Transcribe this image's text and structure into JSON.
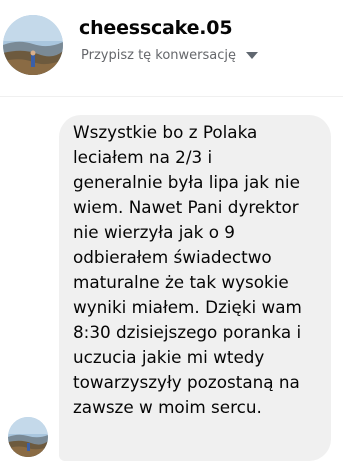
{
  "header": {
    "contact_name": "cheesscake.05",
    "subtitle": "Przypisz tę konwersację",
    "avatar_icon": "profile-photo-icon",
    "dropdown_icon": "chevron-down-icon"
  },
  "messages": [
    {
      "text": "Wszystkie bo z Polaka\nleciałem na 2/3 i\ngeneralnie była lipa jak nie\nwiem. Nawet Pani dyrektor\nnie wierzyła jak o 9\nodbierałem świadectwo\nmaturalne że tak wysokie\nwyniki miałem. Dzięki wam\n8:30 dzisiejszego poranka i\nuczucia jakie mi wtedy\ntowarzyszyły pozostaną na\nzawsze w moim sercu."
    }
  ],
  "colors": {
    "bubble_background": "#f0f0f0",
    "secondary_text": "#65676b",
    "primary_text": "#050505"
  }
}
